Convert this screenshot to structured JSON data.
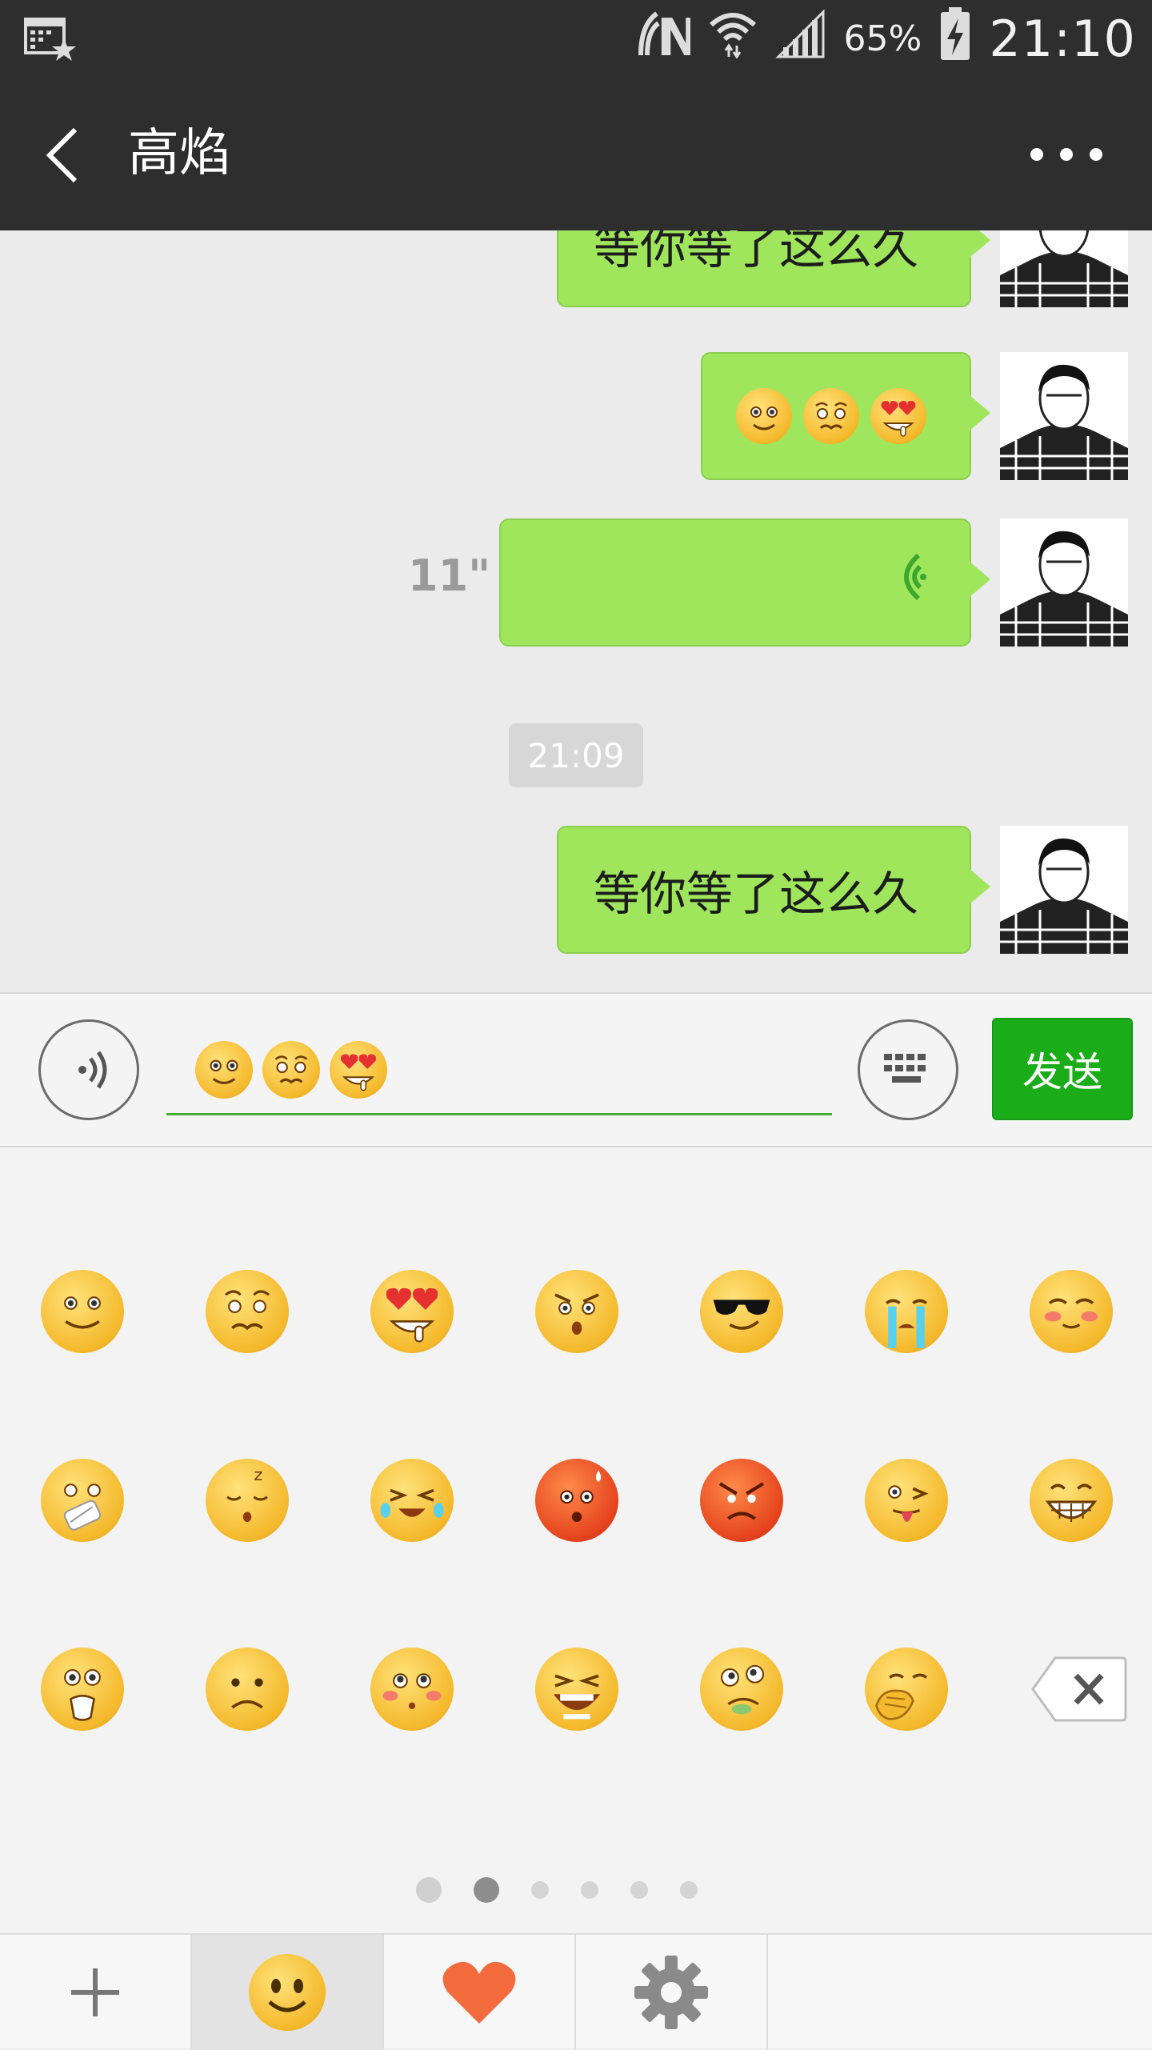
{
  "status_bar": {
    "battery": "65%",
    "time": "21:10"
  },
  "header": {
    "title": "高焰"
  },
  "messages": [
    {
      "type": "text",
      "text": "等你等了这么久"
    },
    {
      "type": "emoji",
      "emojis": [
        "smile-emoji",
        "worried-emoji",
        "heart-eyes-emoji"
      ]
    },
    {
      "type": "voice",
      "duration": "11\""
    },
    {
      "type": "timestamp",
      "text": "21:09"
    },
    {
      "type": "text",
      "text": "等你等了这么久"
    }
  ],
  "input": {
    "send_label": "发送"
  },
  "emoji_panel": {
    "rows": [
      [
        "smile",
        "worried",
        "heart-eyes",
        "angry-face",
        "sunglasses",
        "crying",
        "blush"
      ],
      [
        "zipped",
        "sleepy",
        "laugh-cry",
        "sweat-red",
        "furious",
        "tongue-wink",
        "grin"
      ],
      [
        "surprised",
        "frown",
        "shy",
        "scream",
        "drool",
        "cover-mouth",
        "delete"
      ]
    ],
    "page_count": 6,
    "current_page": 2
  },
  "tabs": [
    "add",
    "emoji",
    "favorites",
    "settings"
  ]
}
